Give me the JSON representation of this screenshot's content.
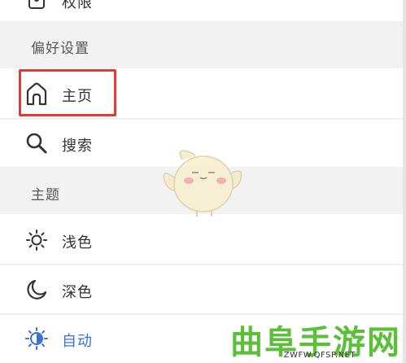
{
  "settings": {
    "permissions": {
      "label": "权限",
      "icon": "permissions-icon"
    },
    "preferences_header": "偏好设置",
    "home": {
      "label": "主页",
      "icon": "home-icon",
      "highlighted": true
    },
    "search": {
      "label": "搜索",
      "icon": "search-icon"
    },
    "theme_header": "主题",
    "theme_options": [
      {
        "label": "浅色",
        "icon": "sun-outline-icon",
        "selected": false
      },
      {
        "label": "深色",
        "icon": "moon-icon",
        "selected": false
      },
      {
        "label": "自动",
        "icon": "auto-brightness-icon",
        "selected": true
      }
    ]
  },
  "colors": {
    "highlight": "#e53935",
    "accent": "#3a6fd8",
    "watermark": "#5cbf3a"
  },
  "watermark": {
    "text": "曲阜手游网",
    "url": "ZWFW.QFSP.NET"
  }
}
